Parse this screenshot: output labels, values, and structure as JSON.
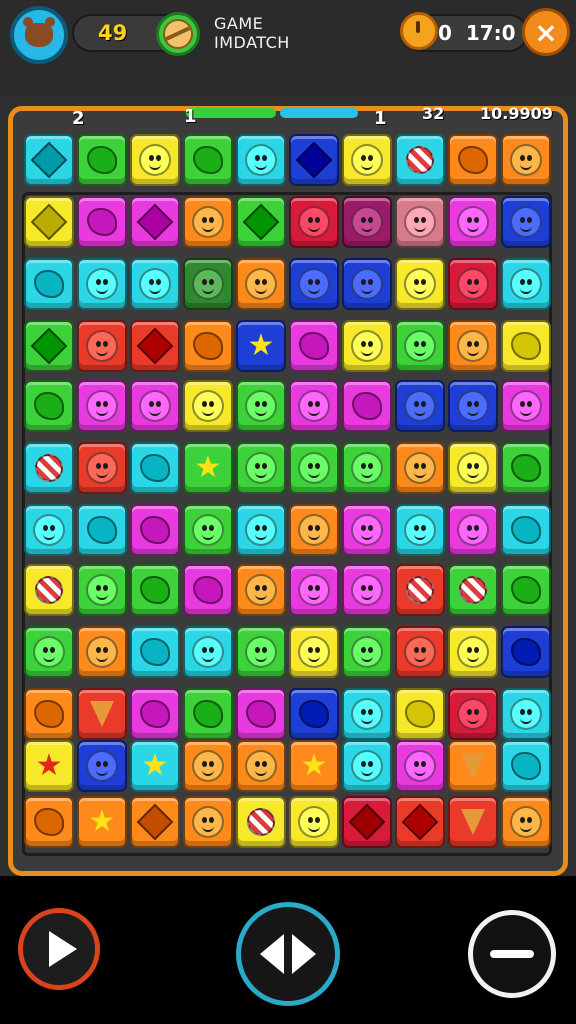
{
  "header": {
    "score": "49",
    "title_line1": "GAME",
    "title_line2": "IMDATCH",
    "timer": "0  17:0",
    "close_label": "×"
  },
  "progress": {
    "marker_left": "2",
    "marker_mid": "1",
    "marker_right": "1",
    "count": "32",
    "total": "10.9909"
  },
  "colors": {
    "board_border": "#e98e1e",
    "progress_green": "#35d13a",
    "progress_blue": "#2bc2e6",
    "play_ring": "#d9441c",
    "swap_ring": "#2aa9c9"
  },
  "grid": {
    "rows": [
      [
        [
          "#2bd7e6",
          "gem"
        ],
        [
          "#3dd13a",
          "blob"
        ],
        [
          "#f7e92a",
          "face"
        ],
        [
          "#3dd13a",
          "blob"
        ],
        [
          "#2bd7e6",
          "face"
        ],
        [
          "#1e3fd6",
          "gem"
        ],
        [
          "#f7e92a",
          "face"
        ],
        [
          "#2bd7e6",
          "sweet"
        ],
        [
          "#ff8a1c",
          "blob"
        ],
        [
          "#ff8a1c",
          "face"
        ]
      ],
      [
        [
          "#f7e92a",
          "gem"
        ],
        [
          "#e93adf",
          "blob"
        ],
        [
          "#e93adf",
          "gem"
        ],
        [
          "#ff8a1c",
          "face"
        ],
        [
          "#3dd13a",
          "gem"
        ],
        [
          "#d81b3a",
          "face"
        ],
        [
          "#9b1b66",
          "face"
        ],
        [
          "#d77a8a",
          "face"
        ],
        [
          "#e93adf",
          "face"
        ],
        [
          "#1e3fd6",
          "face"
        ]
      ],
      [
        [
          "#2bd7e6",
          "blob"
        ],
        [
          "#2bd7e6",
          "face"
        ],
        [
          "#2bd7e6",
          "face"
        ],
        [
          "#2f8a2f",
          "face"
        ],
        [
          "#ff8a1c",
          "face"
        ],
        [
          "#1e3fd6",
          "face"
        ],
        [
          "#1e3fd6",
          "face"
        ],
        [
          "#f7e92a",
          "face"
        ],
        [
          "#d81b3a",
          "face"
        ],
        [
          "#2bd7e6",
          "face"
        ]
      ],
      [
        [
          "#3dd13a",
          "gem"
        ],
        [
          "#e93a2a",
          "face"
        ],
        [
          "#e93a2a",
          "gem"
        ],
        [
          "#ff8a1c",
          "blob"
        ],
        [
          "#1e3fd6",
          "star"
        ],
        [
          "#e93adf",
          "blob"
        ],
        [
          "#f7e92a",
          "face"
        ],
        [
          "#3dd13a",
          "face"
        ],
        [
          "#ff8a1c",
          "face"
        ],
        [
          "#f7e92a",
          "blob"
        ]
      ],
      [
        [
          "#3dd13a",
          "blob"
        ],
        [
          "#e93adf",
          "face"
        ],
        [
          "#e93adf",
          "face"
        ],
        [
          "#f7e92a",
          "face"
        ],
        [
          "#3dd13a",
          "face"
        ],
        [
          "#e93adf",
          "face"
        ],
        [
          "#e93adf",
          "blob"
        ],
        [
          "#1e3fd6",
          "face"
        ],
        [
          "#1e3fd6",
          "face"
        ],
        [
          "#e93adf",
          "face"
        ]
      ],
      [
        [
          "#2bd7e6",
          "sweet"
        ],
        [
          "#e93a2a",
          "face"
        ],
        [
          "#2bd7e6",
          "blob"
        ],
        [
          "#3dd13a",
          "star"
        ],
        [
          "#3dd13a",
          "face"
        ],
        [
          "#3dd13a",
          "face"
        ],
        [
          "#3dd13a",
          "face"
        ],
        [
          "#ff8a1c",
          "face"
        ],
        [
          "#f7e92a",
          "face"
        ],
        [
          "#3dd13a",
          "blob"
        ]
      ],
      [
        [
          "#2bd7e6",
          "face"
        ],
        [
          "#2bd7e6",
          "blob"
        ],
        [
          "#e93adf",
          "blob"
        ],
        [
          "#3dd13a",
          "face"
        ],
        [
          "#2bd7e6",
          "face"
        ],
        [
          "#ff8a1c",
          "face"
        ],
        [
          "#e93adf",
          "face"
        ],
        [
          "#2bd7e6",
          "face"
        ],
        [
          "#e93adf",
          "face"
        ],
        [
          "#2bd7e6",
          "blob"
        ]
      ],
      [
        [
          "#f7e92a",
          "sweet"
        ],
        [
          "#3dd13a",
          "face"
        ],
        [
          "#3dd13a",
          "blob"
        ],
        [
          "#e93adf",
          "blob"
        ],
        [
          "#ff8a1c",
          "face"
        ],
        [
          "#e93adf",
          "face"
        ],
        [
          "#e93adf",
          "face"
        ],
        [
          "#e93a2a",
          "sweet"
        ],
        [
          "#3dd13a",
          "sweet"
        ],
        [
          "#3dd13a",
          "blob"
        ]
      ],
      [
        [
          "#3dd13a",
          "face"
        ],
        [
          "#ff8a1c",
          "face"
        ],
        [
          "#2bd7e6",
          "blob"
        ],
        [
          "#2bd7e6",
          "face"
        ],
        [
          "#3dd13a",
          "face"
        ],
        [
          "#f7e92a",
          "face"
        ],
        [
          "#3dd13a",
          "face"
        ],
        [
          "#e93a2a",
          "face"
        ],
        [
          "#f7e92a",
          "face"
        ],
        [
          "#1e3fd6",
          "blob"
        ]
      ],
      [
        [
          "#ff8a1c",
          "blob"
        ],
        [
          "#e93a2a",
          "cone"
        ],
        [
          "#e93adf",
          "blob"
        ],
        [
          "#3dd13a",
          "blob"
        ],
        [
          "#e93adf",
          "blob"
        ],
        [
          "#1e3fd6",
          "blob"
        ],
        [
          "#2bd7e6",
          "face"
        ],
        [
          "#f7e92a",
          "blob"
        ],
        [
          "#d81b3a",
          "face"
        ],
        [
          "#2bd7e6",
          "face"
        ]
      ],
      [
        [
          "#f7e92a",
          "star"
        ],
        [
          "#1e3fd6",
          "face"
        ],
        [
          "#2bd7e6",
          "star"
        ],
        [
          "#ff8a1c",
          "face"
        ],
        [
          "#ff8a1c",
          "face"
        ],
        [
          "#ff8a1c",
          "star"
        ],
        [
          "#2bd7e6",
          "face"
        ],
        [
          "#e93adf",
          "face"
        ],
        [
          "#ff8a1c",
          "cone"
        ],
        [
          "#2bd7e6",
          "blob"
        ]
      ],
      [
        [
          "#ff8a1c",
          "blob"
        ],
        [
          "#ff8a1c",
          "star"
        ],
        [
          "#ff8a1c",
          "gem"
        ],
        [
          "#ff8a1c",
          "face"
        ],
        [
          "#f7e92a",
          "sweet"
        ],
        [
          "#f7e92a",
          "face"
        ],
        [
          "#d81b3a",
          "gem"
        ],
        [
          "#e93a2a",
          "gem"
        ],
        [
          "#e93a2a",
          "cone"
        ],
        [
          "#ff8a1c",
          "face"
        ]
      ]
    ]
  }
}
